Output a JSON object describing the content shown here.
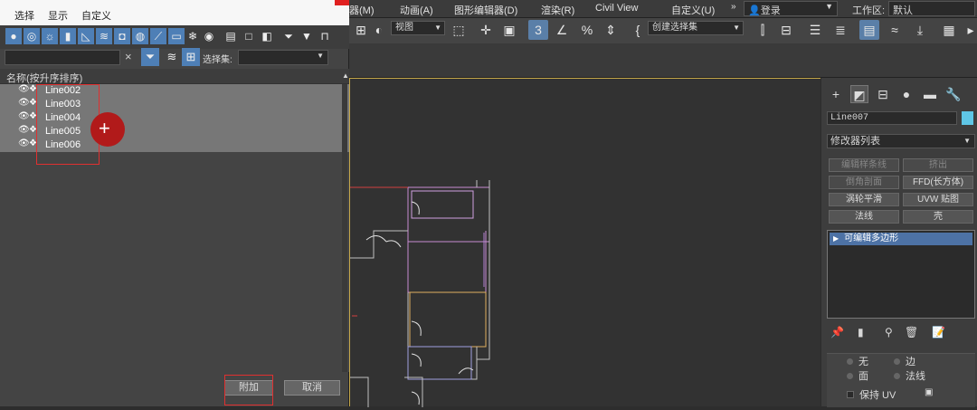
{
  "menubar": {
    "items": [
      "器(M)",
      "动画(A)",
      "图形编辑器(D)",
      "渲染(R)",
      "Civil View",
      "自定义(U)"
    ],
    "login": "登录",
    "workspace_label": "工作区:",
    "workspace_value": "默认"
  },
  "toolbar": {
    "view_dropdown": "视图",
    "selection_set_dropdown": "创建选择集"
  },
  "dialog": {
    "menu": [
      "选择",
      "显示",
      "自定义"
    ],
    "search_placeholder": "",
    "selection_set_label": "选择集:",
    "selection_set_value": "",
    "list_header": "名称(按升序排序)",
    "objects": [
      "Line002",
      "Line003",
      "Line004",
      "Line005",
      "Line006"
    ],
    "attach_label": "附加",
    "cancel_label": "取消"
  },
  "command_panel": {
    "object_name": "Line007",
    "object_color": "#5fc6e6",
    "modifier_list": "修改器列表",
    "modifier_buttons": [
      {
        "label": "编辑样条线",
        "dim": true
      },
      {
        "label": "挤出",
        "dim": true
      },
      {
        "label": "倒角剖面",
        "dim": true
      },
      {
        "label": "FFD(长方体)",
        "dim": false
      },
      {
        "label": "涡轮平滑",
        "dim": false
      },
      {
        "label": "UVW 贴图",
        "dim": false
      },
      {
        "label": "法线",
        "dim": false
      },
      {
        "label": "壳",
        "dim": false
      }
    ],
    "stack_item": "可编辑多边形",
    "rollout": {
      "radio_1": "无",
      "radio_2": "边",
      "radio_3": "面",
      "radio_4": "法线",
      "checkbox": "保持 UV"
    }
  },
  "colors": {
    "accent": "#4e7fb6",
    "highlight_box": "#e03030",
    "cursor": "#b11a1a",
    "viewport_border": "#c6a84a"
  }
}
